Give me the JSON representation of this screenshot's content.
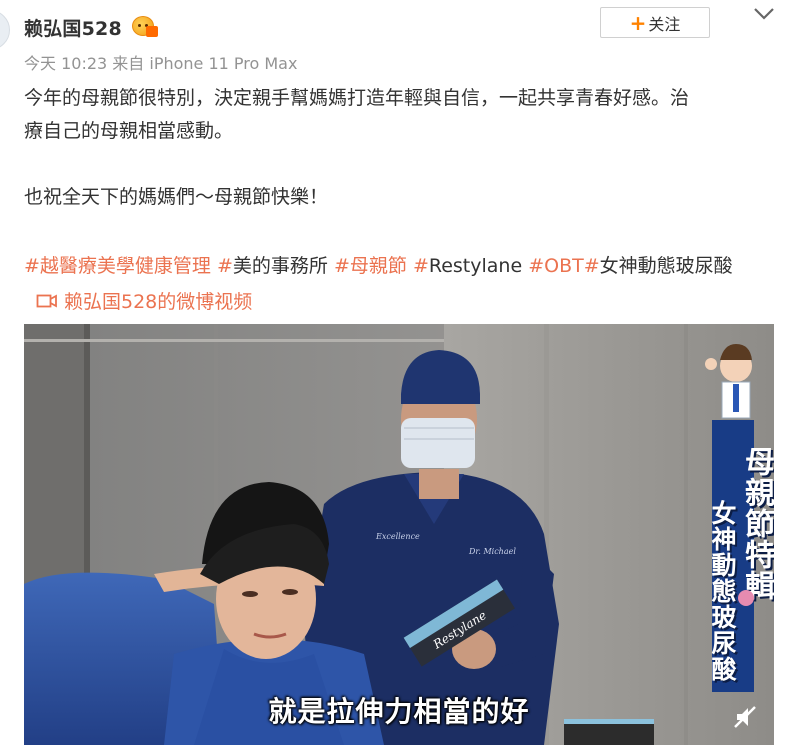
{
  "post": {
    "username": "赖弘国528",
    "follow_label": "关注",
    "meta": "今天 10:23 来自 iPhone 11 Pro Max",
    "paragraph_1": "今年的母親節很特別，決定親手幫媽媽打造年輕與自信，一起共享青春好感。治療自己的母親相當感動。",
    "paragraph_1_line_1": "今年的母親節很特別，決定親手幫媽媽打造年輕與自信，一起共享青春好感。治",
    "paragraph_1_line_2": "療自己的母親相當感動。",
    "paragraph_2": "也祝全天下的媽媽們～母親節快樂！",
    "topics": [
      {
        "hash": "#",
        "text": "越醫療美學健康管理",
        "style": "orange"
      },
      {
        "hash": "#",
        "text": "美的事務所",
        "style": "dark"
      },
      {
        "hash": "#",
        "text": "母親節",
        "style": "orange"
      },
      {
        "hash": "#",
        "text": "Restylane",
        "style": "dark"
      },
      {
        "hash": "#",
        "text": "OBT",
        "style": "orange"
      },
      {
        "hash": "#",
        "text": "女神動態玻尿酸",
        "style": "dark"
      }
    ],
    "video_link_label": "赖弘国528的微博视频"
  },
  "video": {
    "subtitle": "就是拉伸力相當的好",
    "banner_main": "母親節特輯",
    "banner_sub": "女神動態玻尿酸",
    "product_box_text": "Restylane",
    "scrub_text_left": "Excellence",
    "scrub_text_right": "Dr. Michael"
  },
  "icons": {
    "more": "chevron-down-icon",
    "video": "video-camera-icon",
    "mute": "mute-icon",
    "badge": "vip-badge-icon"
  },
  "colors": {
    "accent_orange": "#ff8200",
    "topic_orange": "#eb7350",
    "banner_blue": "#183c86",
    "scrubs_navy": "#1c2e63"
  }
}
